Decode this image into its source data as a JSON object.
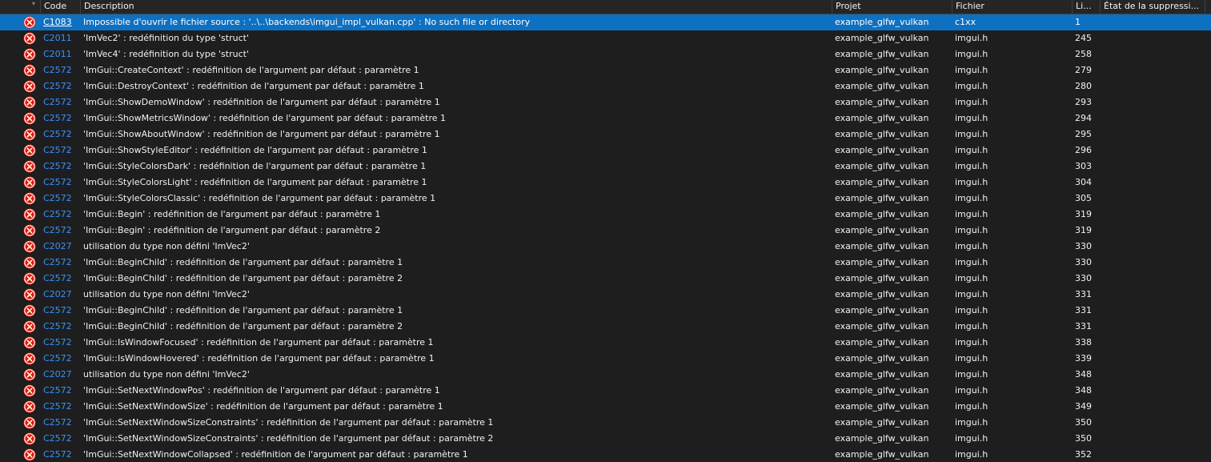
{
  "columns": {
    "code": "Code",
    "description": "Description",
    "project": "Projet",
    "file": "Fichier",
    "line": "Li...",
    "suppression": "État de la suppressi..."
  },
  "colors": {
    "background": "#1e1e1e",
    "selection": "#0e70c0",
    "link": "#3794ff",
    "error_icon": "#e51400"
  },
  "icons": {
    "row_icon": "error-circle-x-icon",
    "header_icon": "sort-glyph-icon"
  },
  "rows": [
    {
      "code": "C1083",
      "description": "Impossible d'ouvrir le fichier source : '..\\..\\backends\\imgui_impl_vulkan.cpp' : No such file or directory",
      "project": "example_glfw_vulkan",
      "file": "c1xx",
      "line": "1",
      "selected": true
    },
    {
      "code": "C2011",
      "description": "'ImVec2' : redéfinition du type 'struct'",
      "project": "example_glfw_vulkan",
      "file": "imgui.h",
      "line": "245"
    },
    {
      "code": "C2011",
      "description": "'ImVec4' : redéfinition du type 'struct'",
      "project": "example_glfw_vulkan",
      "file": "imgui.h",
      "line": "258"
    },
    {
      "code": "C2572",
      "description": "'ImGui::CreateContext' : redéfinition de l'argument par défaut : paramètre 1",
      "project": "example_glfw_vulkan",
      "file": "imgui.h",
      "line": "279"
    },
    {
      "code": "C2572",
      "description": "'ImGui::DestroyContext' : redéfinition de l'argument par défaut : paramètre 1",
      "project": "example_glfw_vulkan",
      "file": "imgui.h",
      "line": "280"
    },
    {
      "code": "C2572",
      "description": "'ImGui::ShowDemoWindow' : redéfinition de l'argument par défaut : paramètre 1",
      "project": "example_glfw_vulkan",
      "file": "imgui.h",
      "line": "293"
    },
    {
      "code": "C2572",
      "description": "'ImGui::ShowMetricsWindow' : redéfinition de l'argument par défaut : paramètre 1",
      "project": "example_glfw_vulkan",
      "file": "imgui.h",
      "line": "294"
    },
    {
      "code": "C2572",
      "description": "'ImGui::ShowAboutWindow' : redéfinition de l'argument par défaut : paramètre 1",
      "project": "example_glfw_vulkan",
      "file": "imgui.h",
      "line": "295"
    },
    {
      "code": "C2572",
      "description": "'ImGui::ShowStyleEditor' : redéfinition de l'argument par défaut : paramètre 1",
      "project": "example_glfw_vulkan",
      "file": "imgui.h",
      "line": "296"
    },
    {
      "code": "C2572",
      "description": "'ImGui::StyleColorsDark' : redéfinition de l'argument par défaut : paramètre 1",
      "project": "example_glfw_vulkan",
      "file": "imgui.h",
      "line": "303"
    },
    {
      "code": "C2572",
      "description": "'ImGui::StyleColorsLight' : redéfinition de l'argument par défaut : paramètre 1",
      "project": "example_glfw_vulkan",
      "file": "imgui.h",
      "line": "304"
    },
    {
      "code": "C2572",
      "description": "'ImGui::StyleColorsClassic' : redéfinition de l'argument par défaut : paramètre 1",
      "project": "example_glfw_vulkan",
      "file": "imgui.h",
      "line": "305"
    },
    {
      "code": "C2572",
      "description": "'ImGui::Begin' : redéfinition de l'argument par défaut : paramètre 1",
      "project": "example_glfw_vulkan",
      "file": "imgui.h",
      "line": "319"
    },
    {
      "code": "C2572",
      "description": "'ImGui::Begin' : redéfinition de l'argument par défaut : paramètre 2",
      "project": "example_glfw_vulkan",
      "file": "imgui.h",
      "line": "319"
    },
    {
      "code": "C2027",
      "description": "utilisation du type non défini 'ImVec2'",
      "project": "example_glfw_vulkan",
      "file": "imgui.h",
      "line": "330"
    },
    {
      "code": "C2572",
      "description": "'ImGui::BeginChild' : redéfinition de l'argument par défaut : paramètre 1",
      "project": "example_glfw_vulkan",
      "file": "imgui.h",
      "line": "330"
    },
    {
      "code": "C2572",
      "description": "'ImGui::BeginChild' : redéfinition de l'argument par défaut : paramètre 2",
      "project": "example_glfw_vulkan",
      "file": "imgui.h",
      "line": "330"
    },
    {
      "code": "C2027",
      "description": "utilisation du type non défini 'ImVec2'",
      "project": "example_glfw_vulkan",
      "file": "imgui.h",
      "line": "331"
    },
    {
      "code": "C2572",
      "description": "'ImGui::BeginChild' : redéfinition de l'argument par défaut : paramètre 1",
      "project": "example_glfw_vulkan",
      "file": "imgui.h",
      "line": "331"
    },
    {
      "code": "C2572",
      "description": "'ImGui::BeginChild' : redéfinition de l'argument par défaut : paramètre 2",
      "project": "example_glfw_vulkan",
      "file": "imgui.h",
      "line": "331"
    },
    {
      "code": "C2572",
      "description": "'ImGui::IsWindowFocused' : redéfinition de l'argument par défaut : paramètre 1",
      "project": "example_glfw_vulkan",
      "file": "imgui.h",
      "line": "338"
    },
    {
      "code": "C2572",
      "description": "'ImGui::IsWindowHovered' : redéfinition de l'argument par défaut : paramètre 1",
      "project": "example_glfw_vulkan",
      "file": "imgui.h",
      "line": "339"
    },
    {
      "code": "C2027",
      "description": "utilisation du type non défini 'ImVec2'",
      "project": "example_glfw_vulkan",
      "file": "imgui.h",
      "line": "348"
    },
    {
      "code": "C2572",
      "description": "'ImGui::SetNextWindowPos' : redéfinition de l'argument par défaut : paramètre 1",
      "project": "example_glfw_vulkan",
      "file": "imgui.h",
      "line": "348"
    },
    {
      "code": "C2572",
      "description": "'ImGui::SetNextWindowSize' : redéfinition de l'argument par défaut : paramètre 1",
      "project": "example_glfw_vulkan",
      "file": "imgui.h",
      "line": "349"
    },
    {
      "code": "C2572",
      "description": "'ImGui::SetNextWindowSizeConstraints' : redéfinition de l'argument par défaut : paramètre 1",
      "project": "example_glfw_vulkan",
      "file": "imgui.h",
      "line": "350"
    },
    {
      "code": "C2572",
      "description": "'ImGui::SetNextWindowSizeConstraints' : redéfinition de l'argument par défaut : paramètre 2",
      "project": "example_glfw_vulkan",
      "file": "imgui.h",
      "line": "350"
    },
    {
      "code": "C2572",
      "description": "'ImGui::SetNextWindowCollapsed' : redéfinition de l'argument par défaut : paramètre 1",
      "project": "example_glfw_vulkan",
      "file": "imgui.h",
      "line": "352"
    }
  ]
}
